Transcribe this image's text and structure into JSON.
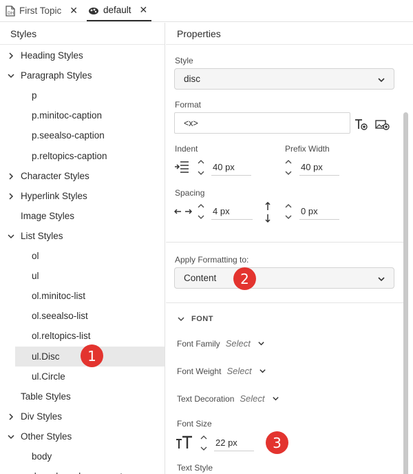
{
  "tabs": [
    {
      "label": "First Topic",
      "icon": "topic-file-icon",
      "active": false
    },
    {
      "label": "default",
      "icon": "stylesheet-icon",
      "active": true
    }
  ],
  "styles_panel": {
    "title": "Styles",
    "items": [
      {
        "label": "Heading Styles",
        "level": 0,
        "expandable": true,
        "expanded": false
      },
      {
        "label": "Paragraph Styles",
        "level": 0,
        "expandable": true,
        "expanded": true
      },
      {
        "label": "p",
        "level": 1
      },
      {
        "label": "p.minitoc-caption",
        "level": 1
      },
      {
        "label": "p.seealso-caption",
        "level": 1
      },
      {
        "label": "p.reltopics-caption",
        "level": 1
      },
      {
        "label": "Character Styles",
        "level": 0,
        "expandable": true,
        "expanded": false
      },
      {
        "label": "Hyperlink Styles",
        "level": 0,
        "expandable": true,
        "expanded": false
      },
      {
        "label": "Image Styles",
        "level": 0,
        "expandable": false
      },
      {
        "label": "List Styles",
        "level": 0,
        "expandable": true,
        "expanded": true
      },
      {
        "label": "ol",
        "level": 1
      },
      {
        "label": "ul",
        "level": 1
      },
      {
        "label": "ol.minitoc-list",
        "level": 1
      },
      {
        "label": "ol.seealso-list",
        "level": 1
      },
      {
        "label": "ol.reltopics-list",
        "level": 1
      },
      {
        "label": "ul.Disc",
        "level": 1,
        "selected": true
      },
      {
        "label": "ul.Circle",
        "level": 1
      },
      {
        "label": "Table Styles",
        "level": 0,
        "expandable": false
      },
      {
        "label": "Div Styles",
        "level": 0,
        "expandable": true,
        "expanded": false
      },
      {
        "label": "Other Styles",
        "level": 0,
        "expandable": true,
        "expanded": true
      },
      {
        "label": "body",
        "level": 1
      },
      {
        "label": ".breadcrumbs-separator",
        "level": 1
      }
    ]
  },
  "properties": {
    "title": "Properties",
    "style_label": "Style",
    "style_value": "disc",
    "format_label": "Format",
    "format_value": "<x>",
    "indent_label": "Indent",
    "indent_value": "40 px",
    "prefix_width_label": "Prefix Width",
    "prefix_width_value": "40 px",
    "spacing_label": "Spacing",
    "spacing_horizontal_value": "4 px",
    "spacing_vertical_value": "0 px",
    "apply_formatting_label": "Apply Formatting to:",
    "apply_formatting_value": "Content",
    "font_section": "FONT",
    "font_family_label": "Font Family",
    "font_family_value": "Select",
    "font_weight_label": "Font Weight",
    "font_weight_value": "Select",
    "text_decoration_label": "Text Decoration",
    "text_decoration_value": "Select",
    "font_size_label": "Font Size",
    "font_size_value": "22 px",
    "text_style_label": "Text Style"
  },
  "callouts": [
    "1",
    "2",
    "3"
  ],
  "colors": {
    "callout": "#e3342f",
    "selected_row": "#e8e8e8"
  }
}
